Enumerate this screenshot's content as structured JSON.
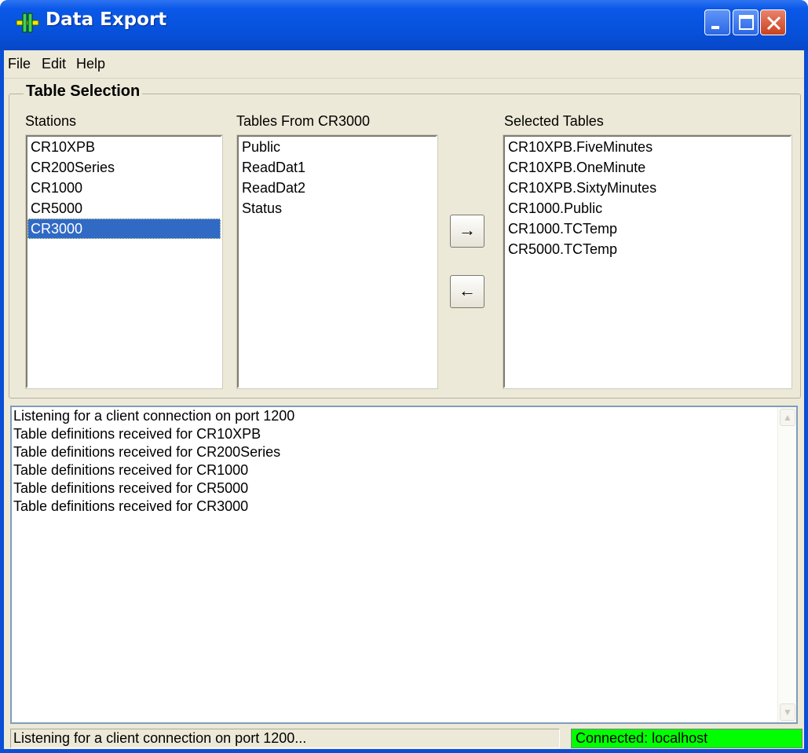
{
  "window": {
    "title": "Data Export",
    "title_bg": "#0a58e8"
  },
  "menu": [
    "File",
    "Edit",
    "Help"
  ],
  "group": {
    "title": "Table Selection"
  },
  "stations": {
    "label": "Stations",
    "items": [
      "CR10XPB",
      "CR200Series",
      "CR1000",
      "CR5000",
      "CR3000"
    ],
    "selected": "CR3000"
  },
  "tables": {
    "label": "Tables From CR3000",
    "items": [
      "Public",
      "ReadDat1",
      "ReadDat2",
      "Status"
    ]
  },
  "selected_tables": {
    "label": "Selected Tables",
    "items": [
      "CR10XPB.FiveMinutes",
      "CR10XPB.OneMinute",
      "CR10XPB.SixtyMinutes",
      "CR1000.Public",
      "CR1000.TCTemp",
      "CR5000.TCTemp"
    ]
  },
  "buttons": {
    "add": "→",
    "remove": "←"
  },
  "log": {
    "lines": [
      "Listening for a client connection on port 1200",
      "Table definitions received for CR10XPB",
      "Table definitions received for CR200Series",
      "Table definitions received for CR1000",
      "Table definitions received for CR5000",
      "Table definitions received for CR3000"
    ]
  },
  "status": {
    "message": "Listening for a client connection on port 1200...",
    "connection": "Connected: localhost",
    "connection_color": "#00ff00"
  },
  "selection_color": "#316ac5"
}
